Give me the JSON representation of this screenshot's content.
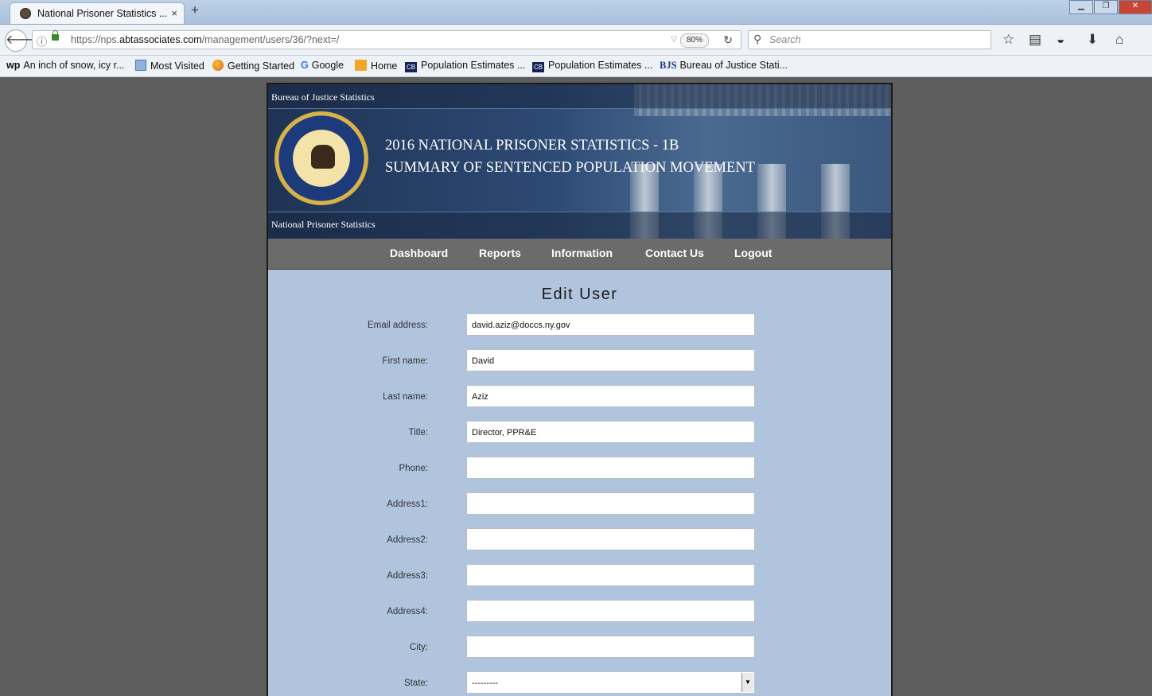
{
  "browser": {
    "tab_title": "National Prisoner Statistics ...",
    "tab_close": "×",
    "new_tab": "+",
    "url_host_prefix": "https://nps.",
    "url_host_domain": "abtassociates.com",
    "url_path": "/management/users/36/?next=/",
    "zoom": "80%",
    "search_placeholder": "Search",
    "bookmarks": [
      {
        "label": "An inch of snow, icy r...",
        "icon_text": "wp"
      },
      {
        "label": "Most Visited"
      },
      {
        "label": "Getting Started"
      },
      {
        "label": "Google",
        "icon_text": "G"
      },
      {
        "label": "Home"
      },
      {
        "label": "Population Estimates ...",
        "icon_text": "CB"
      },
      {
        "label": "Population Estimates ...",
        "icon_text": "CB"
      },
      {
        "label": "Bureau of Justice Stati...",
        "icon_text": "BJS"
      }
    ]
  },
  "banner": {
    "agency": "Bureau of Justice Statistics",
    "title_line1": "2016 NATIONAL PRISONER STATISTICS - 1B",
    "title_line2": "SUMMARY OF SENTENCED POPULATION MOVEMENT",
    "program": "National Prisoner Statistics"
  },
  "menu": {
    "dashboard": "Dashboard",
    "reports": "Reports",
    "information": "Information",
    "contact": "Contact Us",
    "logout": "Logout"
  },
  "form": {
    "title": "Edit User",
    "fields": [
      {
        "label": "Email address:",
        "value": "david.aziz@doccs.ny.gov"
      },
      {
        "label": "First name:",
        "value": "David"
      },
      {
        "label": "Last name:",
        "value": "Aziz"
      },
      {
        "label": "Title:",
        "value": "Director, PPR&E"
      },
      {
        "label": "Phone:",
        "value": ""
      },
      {
        "label": "Address1:",
        "value": ""
      },
      {
        "label": "Address2:",
        "value": ""
      },
      {
        "label": "Address3:",
        "value": ""
      },
      {
        "label": "Address4:",
        "value": ""
      },
      {
        "label": "City:",
        "value": ""
      },
      {
        "label": "State:",
        "value": "---------"
      }
    ]
  }
}
